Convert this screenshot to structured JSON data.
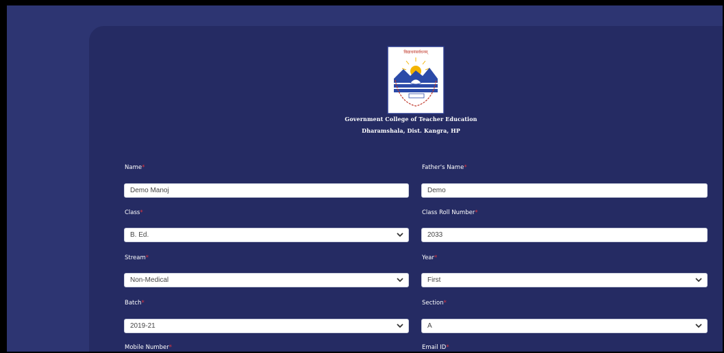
{
  "header": {
    "institution_name": "Government College of Teacher Education",
    "institution_address": "Dharamshala, Dist. Kangra, HP",
    "logo_alt": "Govt. College of Teacher Education emblem"
  },
  "form": {
    "required_mark": "*",
    "name": {
      "label": "Name",
      "value": "Demo Manoj"
    },
    "fathers_name": {
      "label": "Father's Name",
      "value": "Demo"
    },
    "class": {
      "label": "Class",
      "value": "B. Ed."
    },
    "class_roll_number": {
      "label": "Class Roll Number",
      "value": "2033"
    },
    "stream": {
      "label": "Stream",
      "value": "Non-Medical"
    },
    "year": {
      "label": "Year",
      "value": "First"
    },
    "batch": {
      "label": "Batch",
      "value": "2019-21"
    },
    "section": {
      "label": "Section",
      "value": "A"
    },
    "mobile_number": {
      "label": "Mobile Number"
    },
    "email_id": {
      "label": "Email ID"
    }
  },
  "colors": {
    "background": "#2d3572",
    "card": "#252b63",
    "required": "#e0353f"
  }
}
